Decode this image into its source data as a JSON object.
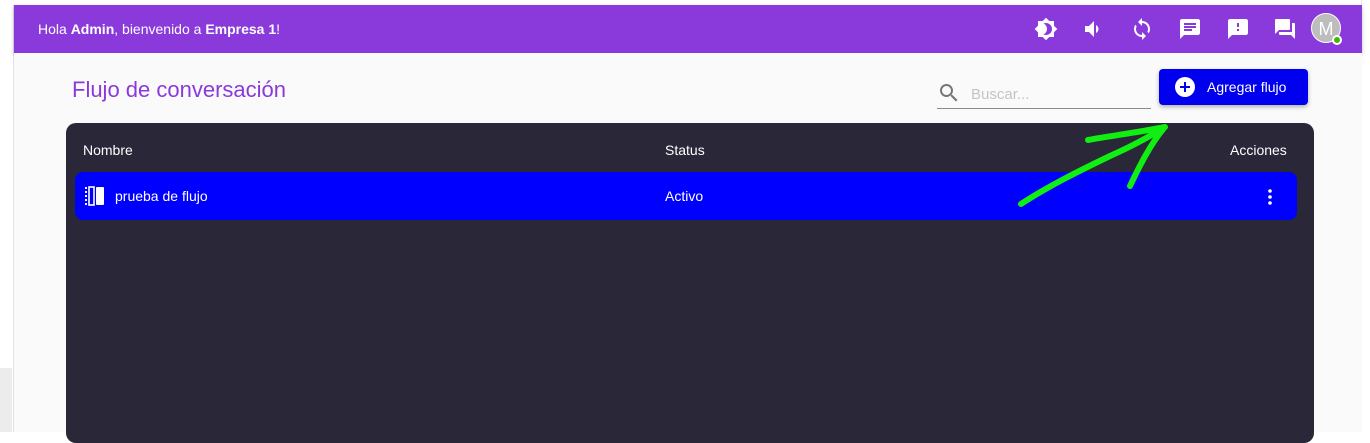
{
  "header": {
    "greeting_prefix": "Hola ",
    "user": "Admin",
    "greeting_middle": ", bienvenido a ",
    "company": "Empresa 1",
    "greeting_suffix": "!",
    "icons": [
      "brightness-icon",
      "volume-icon",
      "sync-icon",
      "chat-icon",
      "alert-icon",
      "forum-icon"
    ],
    "avatar_initial": "M",
    "accent_color": "#8a3adb",
    "online_color": "#44b700"
  },
  "page": {
    "title": "Flujo de conversación"
  },
  "search": {
    "placeholder": "Buscar..."
  },
  "toolbar": {
    "add_label": "Agregar flujo",
    "button_color": "#0000ee"
  },
  "table": {
    "columns": [
      "Nombre",
      "Status",
      "Acciones"
    ],
    "rows": [
      {
        "name": "prueba de flujo",
        "status": "Activo",
        "row_color": "#0000fe"
      }
    ],
    "background": "#292738"
  },
  "annotation": {
    "type": "hand-drawn-arrow",
    "color": "#11ee11"
  }
}
